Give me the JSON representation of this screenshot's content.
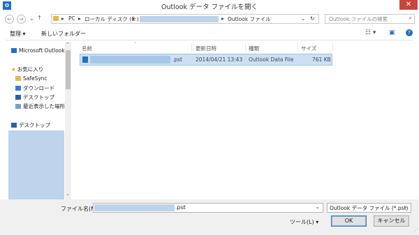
{
  "window": {
    "title": "Outlook データ ファイルを開く",
    "app_icon": "outlook-icon",
    "close_glyph": "✕"
  },
  "address_bar": {
    "back_glyph": "←",
    "forward_glyph": "→",
    "recent_glyph": "⌄",
    "up_glyph": "↑",
    "breadcrumb": [
      "PC",
      "ローカル ディスク (C:)",
      "Outlook ファイル"
    ],
    "separator": "▸",
    "dropdown_glyph": "⌄",
    "refresh_glyph": "↻",
    "search_placeholder": "Outlook ファイルの検索",
    "search_glyph": "⌕"
  },
  "toolbar": {
    "organize_label": "整理 ▾",
    "new_folder_label": "新しいフォルダー",
    "view_glyph": "☷ ▾",
    "preview_glyph": "▣",
    "help_glyph": "?"
  },
  "nav": {
    "top_item": "Microsoft Outlook",
    "favorites_label": "お気に入り",
    "items": [
      "SafeSync",
      "ダウンロード",
      "デスクトップ",
      "最近表示した場所"
    ],
    "desktop_label": "デスクトップ",
    "scroll_down_glyph": "⌄",
    "scroll_up_glyph": "⌃"
  },
  "columns": {
    "name": "名前",
    "date": "更新日時",
    "type": "種類",
    "size": "サイズ",
    "sort_glyph": "⌃"
  },
  "files": [
    {
      "name_suffix": ".pst",
      "date": "2014/04/21 13:43",
      "type": "Outlook Data File",
      "size": "761 KB"
    }
  ],
  "footer": {
    "filename_label": "ファイル名(N):",
    "filename_suffix": ".pst",
    "filename_drop_glyph": "⌄",
    "filter_label": "Outlook データ ファイル (*.pst)",
    "filter_drop_glyph": "⌄",
    "tools_label": "ツール(L)  ▾",
    "ok_label": "OK",
    "cancel_label": "キャンセル"
  },
  "colors": {
    "selection": "#cce0f5",
    "redaction": "#bed3ec",
    "close_button": "#c7463c",
    "accent": "#1f6fc4"
  }
}
